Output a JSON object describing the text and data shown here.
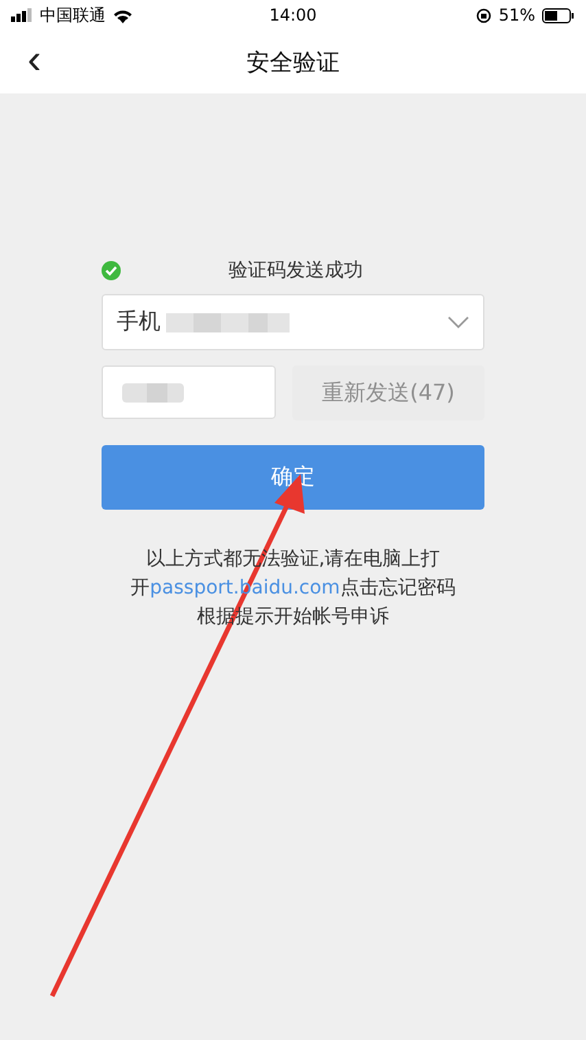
{
  "status_bar": {
    "carrier": "中国联通",
    "time": "14:00",
    "battery": "51%"
  },
  "nav": {
    "back": "‹",
    "title": "安全验证"
  },
  "status_message": {
    "text": "验证码发送成功",
    "success": true
  },
  "phone_select": {
    "value": "手机"
  },
  "resend_button": {
    "label": "重新发送(47)",
    "disabled": true
  },
  "confirm_button": {
    "label": "确定"
  },
  "help": {
    "line_1": "以上方式都无法验证,请在电脑上打",
    "line_2_before": "开",
    "link": "passport.baidu.com",
    "line_2_after": "点击忘记密码",
    "line_3": "根据提示开始帐号申诉"
  }
}
